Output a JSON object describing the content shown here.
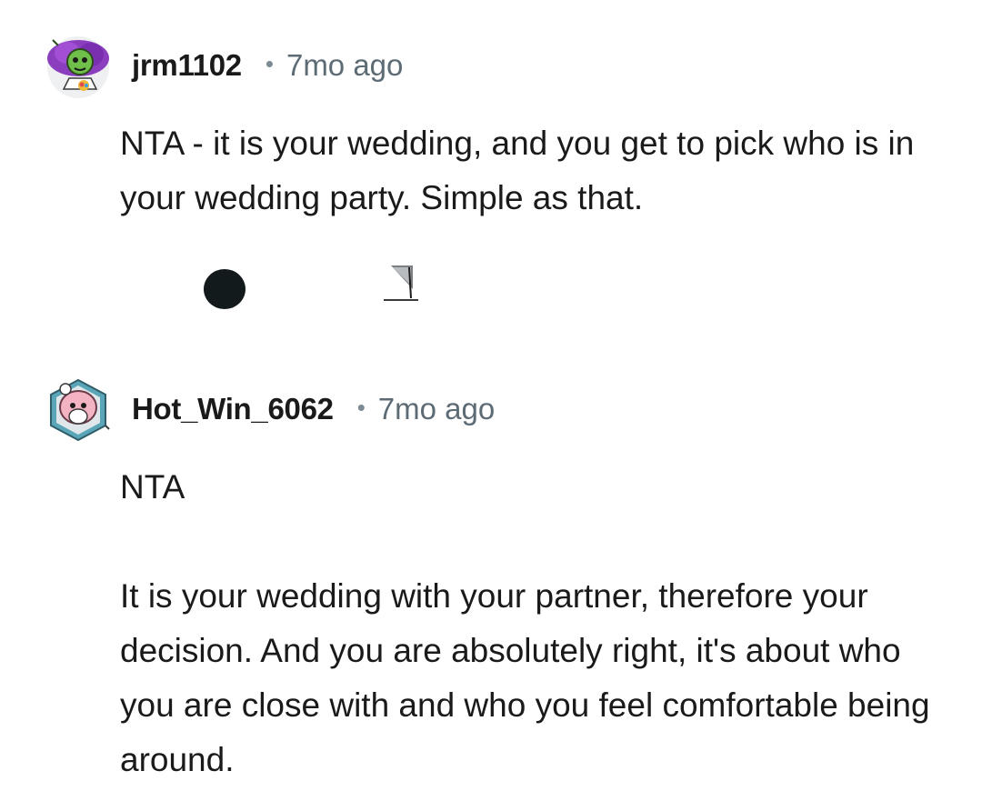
{
  "comments": [
    {
      "username": "jrm1102",
      "separator": "•",
      "time": "7mo ago",
      "avatar_icon": "reddit-avatar-purple-hair-icon",
      "paragraphs": [
        "NTA - it is your wedding, and you get to pick who is in your wedding party. Simple as that."
      ]
    },
    {
      "username": "Hot_Win_6062",
      "separator": "•",
      "time": "7mo ago",
      "avatar_icon": "reddit-avatar-pink-helmet-icon",
      "paragraphs": [
        "NTA",
        "It is your wedding with your partner, therefore your decision. And you are absolutely right, it's about who you are close with and who you feel comfortable being around."
      ]
    }
  ],
  "colors": {
    "text": "#1a1a1b",
    "meta": "#5d6b75",
    "dot_button": "#131a1c"
  }
}
